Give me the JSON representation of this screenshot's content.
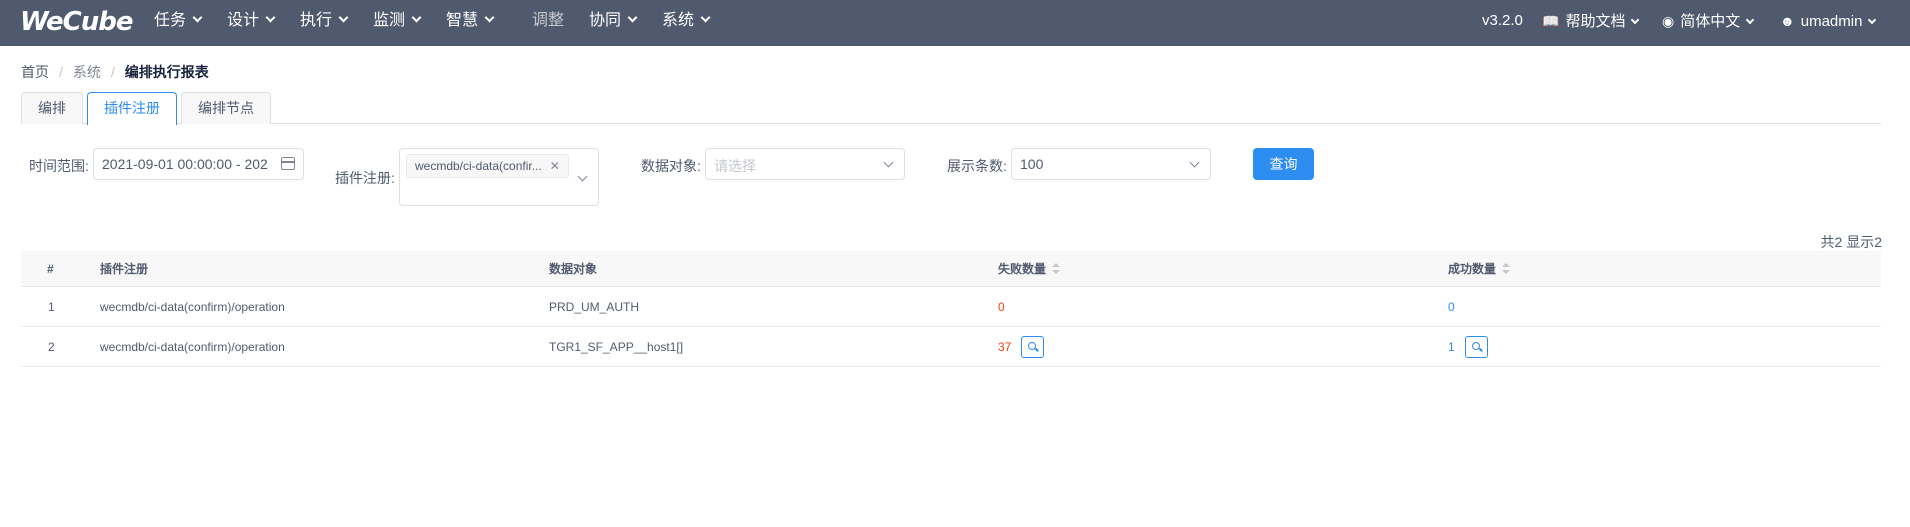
{
  "header": {
    "logo": "WeCube",
    "nav": [
      "任务",
      "设计",
      "执行",
      "监测",
      "智慧",
      "调整",
      "协同",
      "系统"
    ],
    "version": "v3.2.0",
    "help": "帮助文档",
    "language": "简体中文",
    "user": "umadmin"
  },
  "breadcrumb": [
    "首页",
    "系统",
    "编排执行报表"
  ],
  "tabs": [
    "编排",
    "插件注册",
    "编排节点"
  ],
  "active_tab": 1,
  "filters": {
    "time_label": "时间范围:",
    "time_value": "2021-09-01 00:00:00 - 202",
    "plugin_label": "插件注册:",
    "plugin_tag": "wecmdb/ci-data(confir...",
    "data_object_label": "数据对象:",
    "data_object_placeholder": "请选择",
    "count_label": "展示条数:",
    "count_value": "100",
    "query_button": "查询"
  },
  "summary": "共2 显示2",
  "table": {
    "columns": [
      "#",
      "插件注册",
      "数据对象",
      "失败数量",
      "成功数量"
    ],
    "rows": [
      {
        "index": "1",
        "plugin": "wecmdb/ci-data(confirm)/operation",
        "data_object": "PRD_UM_AUTH",
        "failed": "0",
        "success": "0"
      },
      {
        "index": "2",
        "plugin": "wecmdb/ci-data(confirm)/operation",
        "data_object": "TGR1_SF_APP__host1[]",
        "failed": "37",
        "success": "1"
      }
    ]
  },
  "colors": {
    "header_bg": "#505a6e",
    "primary": "#2d8cf0",
    "danger": "#ed4014"
  }
}
